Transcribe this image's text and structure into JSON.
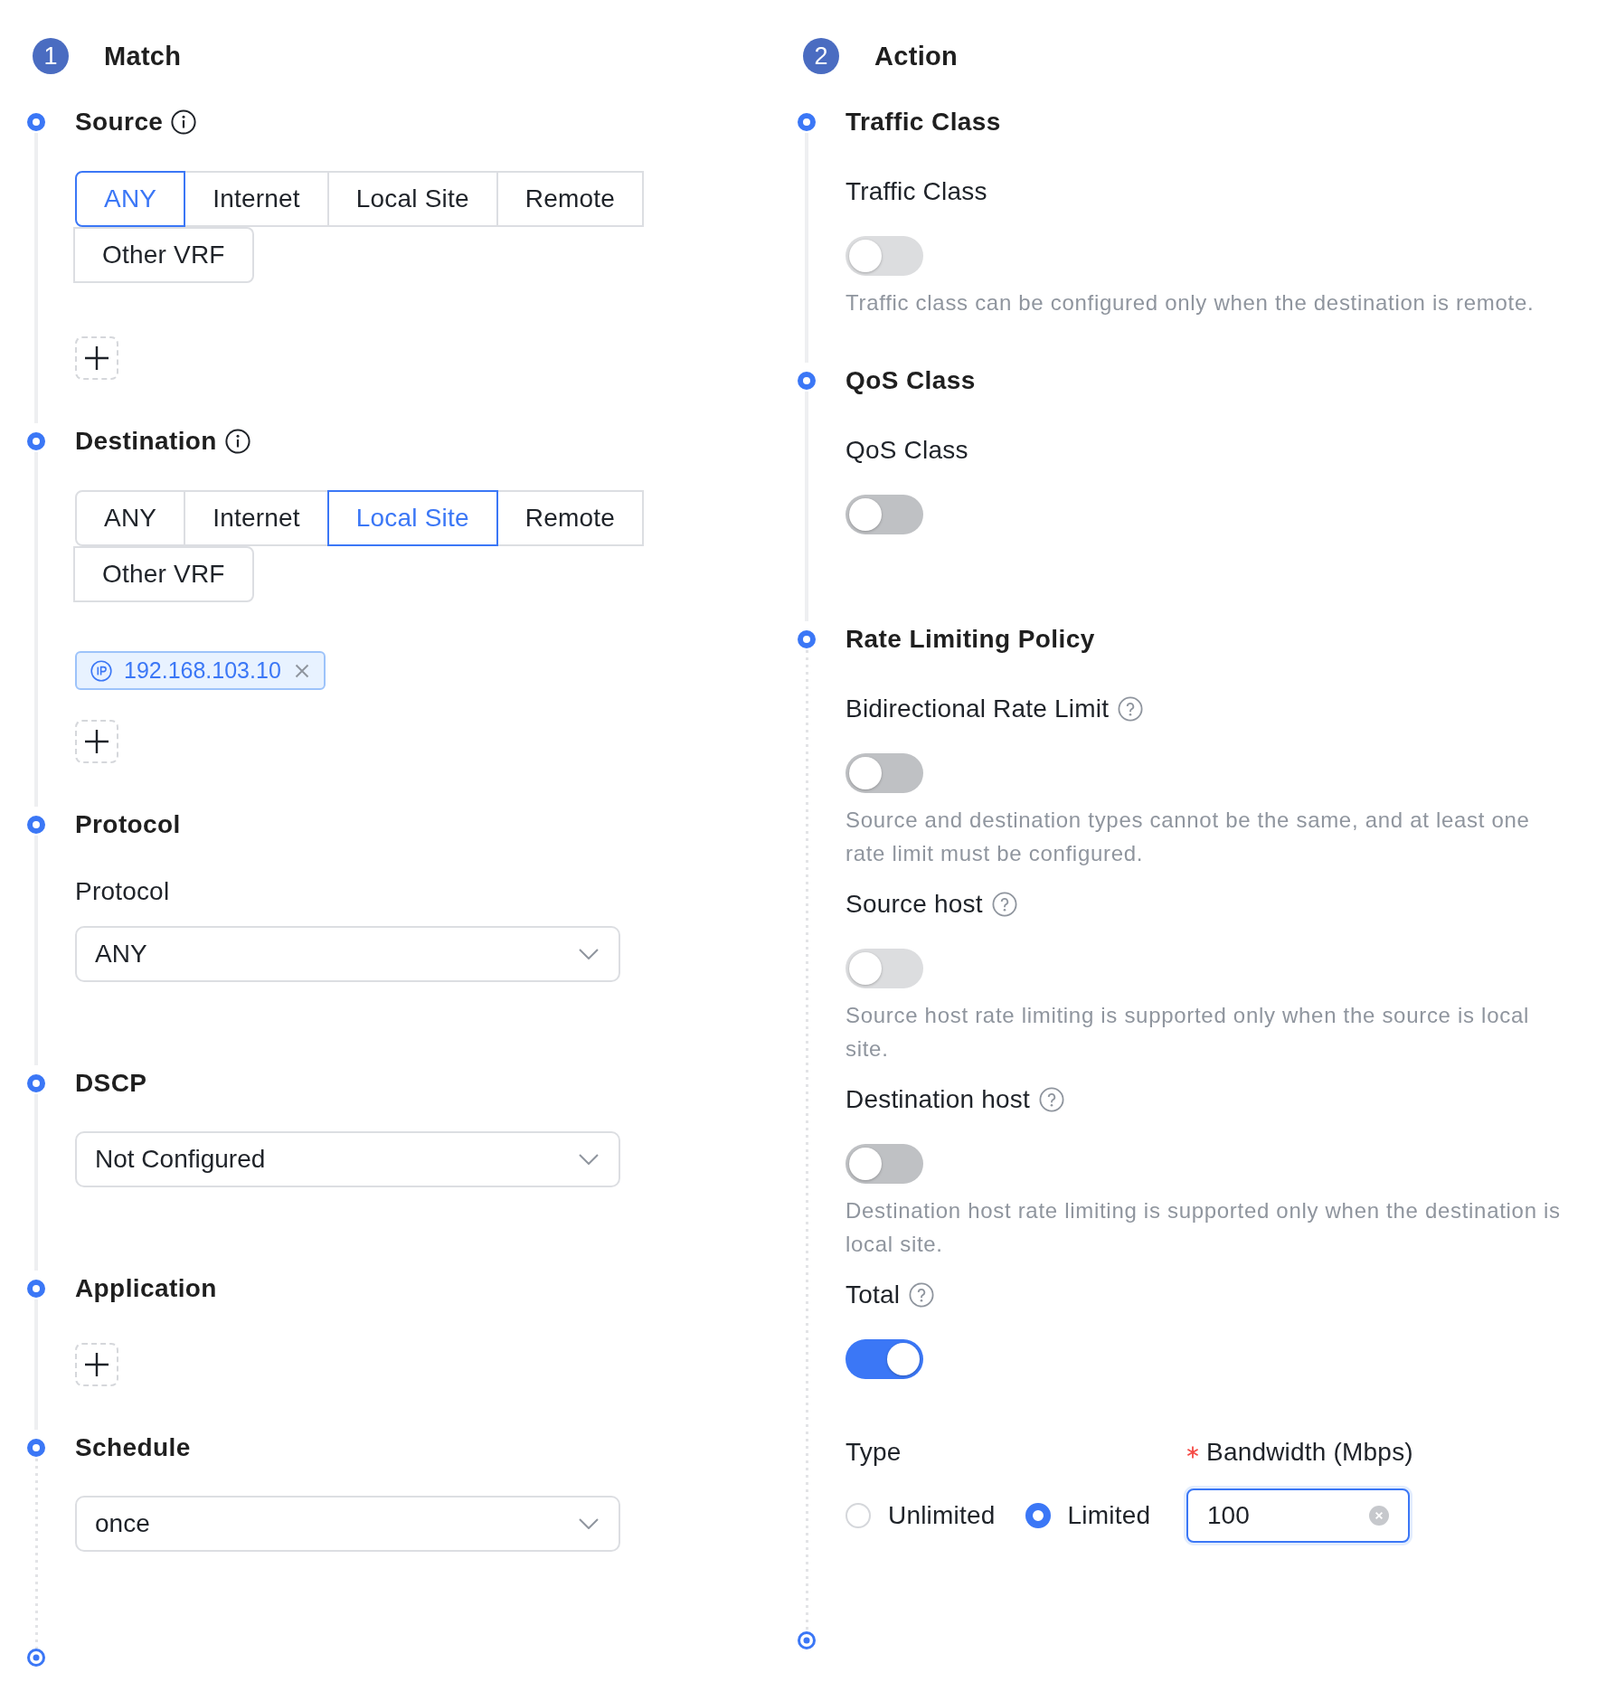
{
  "match": {
    "step": "1",
    "title": "Match",
    "sections": [
      {
        "kind": "choice",
        "title": "Source",
        "info_icon": true,
        "options": [
          {
            "label": "ANY",
            "selected": true
          },
          {
            "label": "Internet",
            "selected": false
          },
          {
            "label": "Local Site",
            "selected": false
          },
          {
            "label": "Remote",
            "selected": false
          },
          {
            "label": "Other VRF",
            "selected": false
          }
        ],
        "add_button": true
      },
      {
        "kind": "choice",
        "title": "Destination",
        "info_icon": true,
        "options": [
          {
            "label": "ANY",
            "selected": false
          },
          {
            "label": "Internet",
            "selected": false
          },
          {
            "label": "Local Site",
            "selected": true
          },
          {
            "label": "Remote",
            "selected": false
          },
          {
            "label": "Other VRF",
            "selected": false
          }
        ],
        "tags": [
          "192.168.103.10"
        ],
        "add_button": true
      },
      {
        "kind": "select",
        "title": "Protocol",
        "label": "Protocol",
        "value": "ANY"
      },
      {
        "kind": "select",
        "title": "DSCP",
        "value": "Not Configured"
      },
      {
        "kind": "add",
        "title": "Application",
        "add_button": true
      },
      {
        "kind": "select",
        "title": "Schedule",
        "value": "once"
      }
    ]
  },
  "action": {
    "step": "2",
    "title": "Action",
    "sections": [
      {
        "title": "Traffic Class",
        "fields": [
          {
            "kind": "toggle",
            "label": "Traffic Class",
            "on": false,
            "disabled": true,
            "hint": "Traffic class can be configured only when the destination is remote."
          }
        ]
      },
      {
        "title": "QoS Class",
        "fields": [
          {
            "kind": "toggle",
            "label": "QoS Class",
            "on": false,
            "disabled": false
          }
        ]
      },
      {
        "title": "Rate Limiting Policy",
        "fields": [
          {
            "kind": "toggle",
            "label": "Bidirectional Rate Limit",
            "help_icon": true,
            "on": false,
            "disabled": false,
            "hint": "Source and destination types cannot be the same, and at least one rate limit must be configured."
          },
          {
            "kind": "toggle",
            "label": "Source host",
            "help_icon": true,
            "on": false,
            "disabled": true,
            "hint": "Source host rate limiting is supported only when the source is local site."
          },
          {
            "kind": "toggle",
            "label": "Destination host",
            "help_icon": true,
            "on": false,
            "disabled": false,
            "hint": "Destination host rate limiting is supported only when the destination is local site."
          },
          {
            "kind": "toggle",
            "label": "Total",
            "help_icon": true,
            "on": true,
            "disabled": false
          },
          {
            "kind": "type_bandwidth",
            "type": {
              "label": "Type",
              "options": [
                {
                  "label": "Unlimited",
                  "selected": false
                },
                {
                  "label": "Limited",
                  "selected": true
                }
              ]
            },
            "bandwidth": {
              "label": "Bandwidth (Mbps)",
              "required": true,
              "value": "100",
              "focused": true
            }
          }
        ]
      }
    ]
  }
}
